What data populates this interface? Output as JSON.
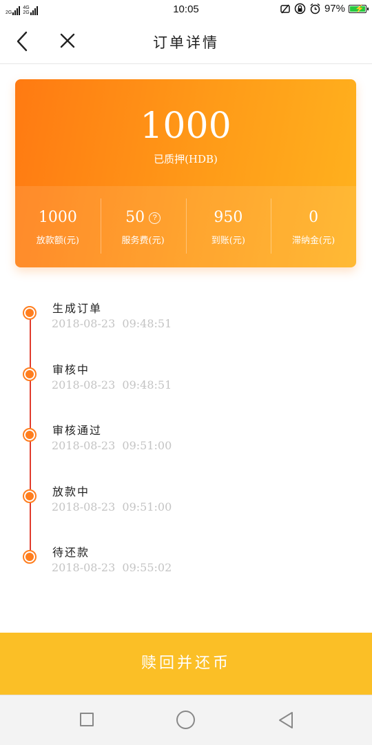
{
  "status_bar": {
    "sim_labels": [
      "2G",
      "4G",
      "2G"
    ],
    "time": "10:05",
    "battery": "97%",
    "battery_level": 0.97,
    "icons": [
      "signal-icon",
      "alarm-off-icon",
      "lock-rotation-icon",
      "alarm-clock-icon",
      "battery-icon"
    ]
  },
  "header": {
    "title": "订单详情",
    "back_icon": "chevron-left-icon",
    "close_icon": "close-icon"
  },
  "summary": {
    "amount": "1000",
    "amount_label": "已质押(HDB)",
    "stats": [
      {
        "value": "1000",
        "label": "放款额(元)"
      },
      {
        "value": "50",
        "label": "服务费(元)",
        "has_help": true
      },
      {
        "value": "950",
        "label": "到账(元)"
      },
      {
        "value": "0",
        "label": "滞纳金(元)"
      }
    ]
  },
  "timeline": [
    {
      "title": "生成订单",
      "time": "2018-08-23  09:48:51"
    },
    {
      "title": "审核中",
      "time": "2018-08-23  09:48:51"
    },
    {
      "title": "审核通过",
      "time": "2018-08-23  09:51:00"
    },
    {
      "title": "放款中",
      "time": "2018-08-23  09:51:00"
    },
    {
      "title": "待还款",
      "time": "2018-08-23  09:55:02"
    }
  ],
  "action": {
    "label": "赎回并还币"
  },
  "colors": {
    "accent": "#ff7a12",
    "action_bg": "#fbbf26",
    "timeline_line": "#e03a2c"
  }
}
